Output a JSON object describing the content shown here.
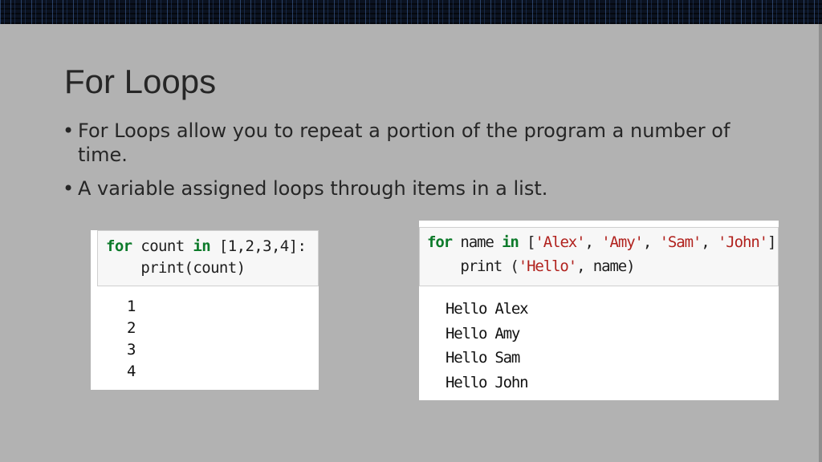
{
  "slide": {
    "title": "For Loops",
    "bullets": [
      "For Loops allow you to repeat a portion of the program a number of time.",
      "A variable assigned loops through items in a list."
    ]
  },
  "example_numbers": {
    "code": {
      "kw_for": "for",
      "var": " count ",
      "kw_in": "in",
      "list_text": " [1,2,3,4]:",
      "print_indent": "    ",
      "print_call": "print(count)"
    },
    "output": [
      "1",
      "2",
      "3",
      "4"
    ]
  },
  "example_names": {
    "code": {
      "kw_for": "for",
      "var": " name ",
      "kw_in": "in",
      "open": " [",
      "items": [
        "'Alex'",
        "'Amy'",
        "'Sam'",
        "'John'"
      ],
      "sep1": ", ",
      "sep2": ", ",
      "sep3": ", ",
      "close": "]:",
      "print_indent": "    ",
      "print_fn": "print (",
      "print_str": "'Hello'",
      "print_rest": ", name)"
    },
    "output": [
      "Hello Alex",
      "Hello Amy",
      "Hello Sam",
      "Hello John"
    ]
  },
  "colors": {
    "background": "#b2b2b2",
    "text": "#262626",
    "keyword": "#0c7a2a",
    "string": "#b1221e"
  }
}
